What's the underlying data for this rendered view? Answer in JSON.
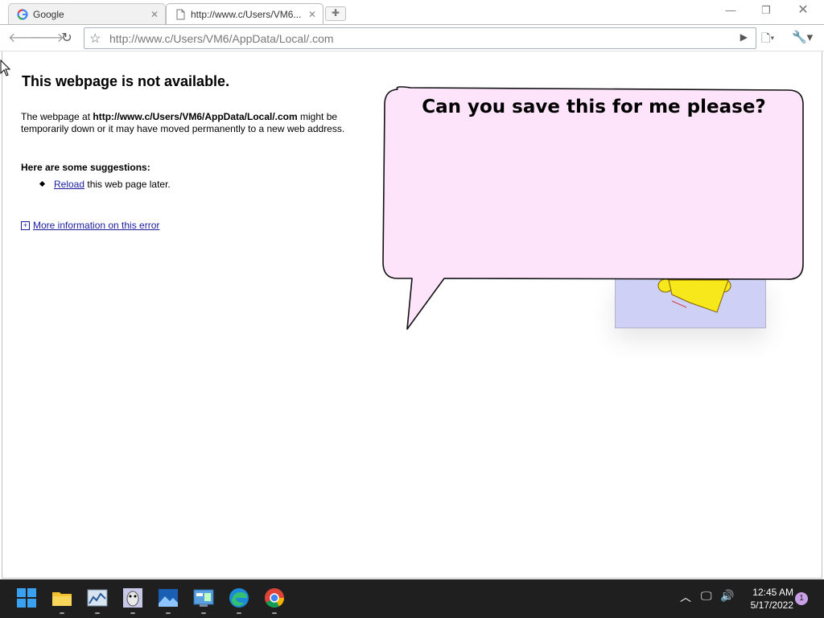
{
  "tabs": [
    {
      "title": "Google",
      "active": false
    },
    {
      "title": "http://www.c/Users/VM6...",
      "active": true
    }
  ],
  "address_bar": {
    "url": "http://www.c/Users/VM6/AppData/Local/.com"
  },
  "error_page": {
    "title": "This webpage is not available.",
    "desc_prefix": "The webpage at ",
    "desc_url": "http://www.c/Users/VM6/AppData/Local/.com",
    "desc_suffix": " might be temporarily down or it may have moved permanently to a new web address.",
    "suggestions_title": "Here are some suggestions:",
    "reload_link": "Reload",
    "reload_suffix": " this web page later.",
    "more_info_link": "More information on this error"
  },
  "speech_bubble": {
    "text": "Can you save this for me please?"
  },
  "taskbar": {
    "apps": [
      "start-icon",
      "file-explorer-icon",
      "chart-app-icon",
      "character-app-icon",
      "photos-icon",
      "control-panel-icon",
      "edge-icon",
      "chrome-icon"
    ],
    "clock_time": "12:45 AM",
    "clock_date": "5/17/2022",
    "notification_count": "1"
  },
  "colors": {
    "link": "#1c1ca0",
    "bubble_fill": "#fde4fb",
    "assistant_bg": "#cfd0f6",
    "taskbar": "#1f1f1f"
  }
}
